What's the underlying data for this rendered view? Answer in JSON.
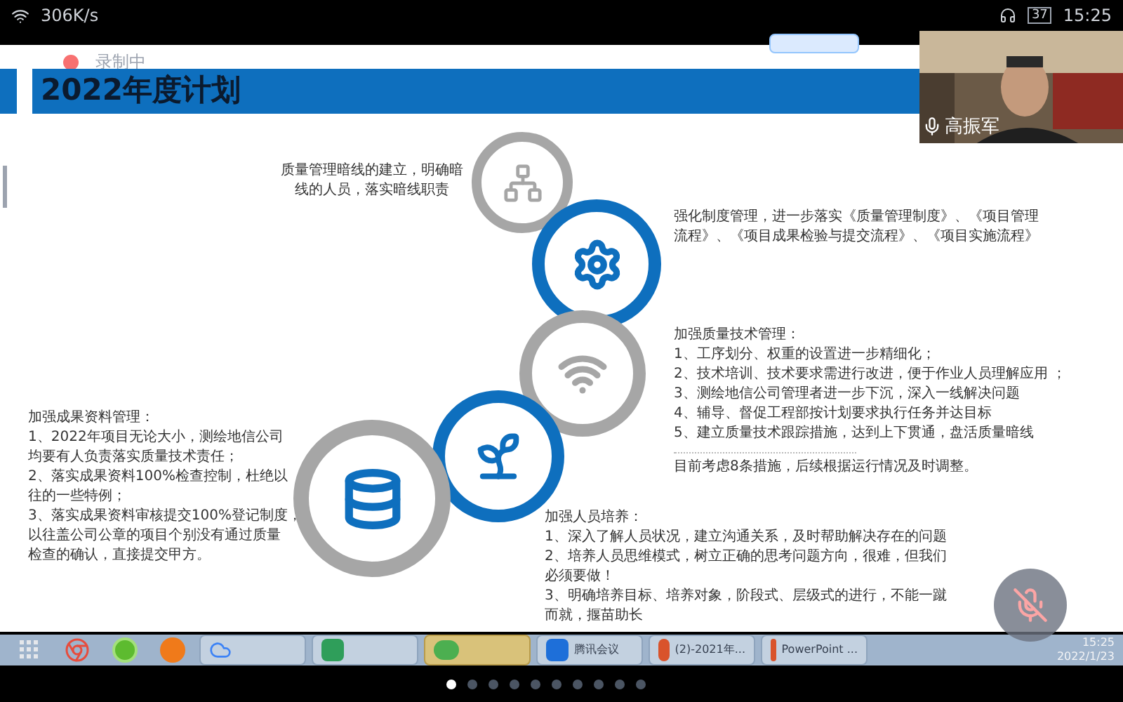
{
  "status_bar": {
    "speed": "306K/s",
    "battery": "37",
    "time": "15:25"
  },
  "recording": {
    "label": "录制中",
    "on": true
  },
  "slide": {
    "title": "2022年度计划",
    "circles": [
      {
        "kind": "hierarchy",
        "color": "#a6a6a6"
      },
      {
        "kind": "gears",
        "color": "#0e6fbe"
      },
      {
        "kind": "wifi",
        "color": "#a6a6a6"
      },
      {
        "kind": "leaf",
        "color": "#0e6fbe"
      },
      {
        "kind": "database",
        "color": "#a6a6a6"
      }
    ],
    "blocks": [
      {
        "lines": [
          "质量管理暗线的建立，明确暗",
          "线的人员，落实暗线职责"
        ]
      },
      {
        "lines": [
          "强化制度管理，进一步落实《质量管理制度》、《项目管理",
          "流程》、《项目成果检验与提交流程》、《项目实施流程》"
        ]
      },
      {
        "lines": [
          "加强质量技术管理：",
          "1、工序划分、权重的设置进一步精细化；",
          "2、技术培训、技术要求需进行改进，便于作业人员理解应用 ；",
          "3、测绘地信公司管理者进一步下沉，深入一线解决问题",
          "4、辅导、督促工程部按计划要求执行任务并达目标",
          "5、建立质量技术跟踪措施，达到上下贯通，盘活质量暗线"
        ]
      },
      {
        "lines": [
          "加强成果资料管理：",
          "1、2022年项目无论大小，测绘地信公司",
          "均要有人负责落实质量技术责任；",
          "2、落实成果资料100%检查控制，杜绝以",
          "往的一些特例；",
          "3、落实成果资料审核提交100%登记制度，",
          "以往盖公司公章的项目个别没有通过质量",
          "检查的确认，直接提交甲方。"
        ]
      },
      {
        "lines": [
          "目前考虑8条措施，后续根据运行情况及时调整。"
        ]
      },
      {
        "lines": [
          "加强人员培养：",
          "1、深入了解人员状况，建立沟通关系，及时帮助解决存在的问题",
          "2、培养人员思维模式，树立正确的思考问题方向，很难，但我们",
          "必须要做！",
          "3、明确培养目标、培养对象，阶段式、层级式的进行，不能一蹴",
          "而就，揠苗助长"
        ]
      }
    ]
  },
  "video": {
    "name": "高振军",
    "muted": false
  },
  "mic_button": {
    "muted": true
  },
  "taskbar": {
    "items": [
      {
        "kind": "grid",
        "selected": false
      },
      {
        "kind": "chrome",
        "selected": false
      },
      {
        "kind": "green",
        "selected": false
      },
      {
        "kind": "orange",
        "selected": false
      },
      {
        "kind": "cloud",
        "selected": false
      },
      {
        "kind": "wen",
        "selected": false
      },
      {
        "kind": "wechat",
        "selected": true
      },
      {
        "kind": "meeting",
        "label": "腾讯会议",
        "selected": false
      },
      {
        "kind": "ppt",
        "label": "(2)-2021年...",
        "selected": false
      },
      {
        "kind": "ppt",
        "label": "PowerPoint ...",
        "selected": false
      }
    ],
    "clock": {
      "time": "15:25",
      "date": "2022/1/23"
    }
  },
  "pages": [
    {
      "selected": true
    },
    {
      "selected": false
    },
    {
      "selected": false
    },
    {
      "selected": false
    },
    {
      "selected": false
    },
    {
      "selected": false
    },
    {
      "selected": false
    },
    {
      "selected": false
    },
    {
      "selected": false
    },
    {
      "selected": false
    }
  ]
}
